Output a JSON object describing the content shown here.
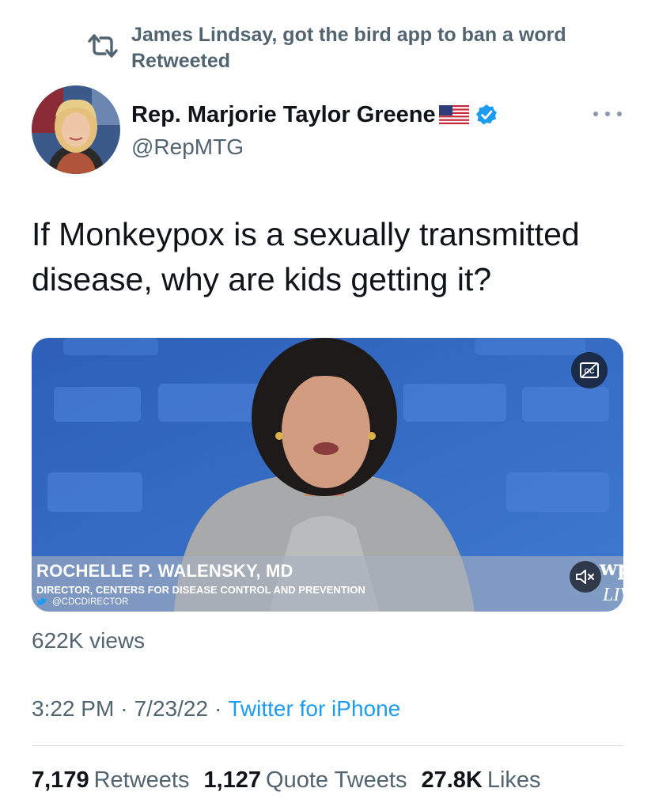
{
  "retweet_context": {
    "text": "James Lindsay, got the bird app to ban a word Retweeted",
    "icon": "retweet-icon"
  },
  "author": {
    "display_name": "Rep. Marjorie Taylor Greene",
    "handle": "@RepMTG",
    "flag_icon": "us-flag-icon",
    "verified_icon": "verified-badge-icon"
  },
  "tweet": {
    "text": "If Monkeypox is a sexually transmitted disease, why are kids getting it?"
  },
  "media": {
    "lower_third_name": "ROCHELLE P. WALENSKY, MD",
    "lower_third_title": "DIRECTOR, CENTERS FOR DISEASE CONTROL AND PREVENTION",
    "lower_third_handle": "@CDCDIRECTOR",
    "watermark": "wp",
    "live_label": "LIV"
  },
  "views": "622K views",
  "meta": {
    "time": "3:22 PM",
    "date": "7/23/22",
    "separator": "·",
    "source": "Twitter for iPhone"
  },
  "stats": {
    "retweets_count": "7,179",
    "retweets_label": "Retweets",
    "quotes_count": "1,127",
    "quotes_label": "Quote Tweets",
    "likes_count": "27.8K",
    "likes_label": "Likes"
  },
  "colors": {
    "link": "#1d9bf0",
    "secondary_text": "#536471",
    "primary_text": "#0f1419",
    "verified": "#1d9bf0"
  }
}
